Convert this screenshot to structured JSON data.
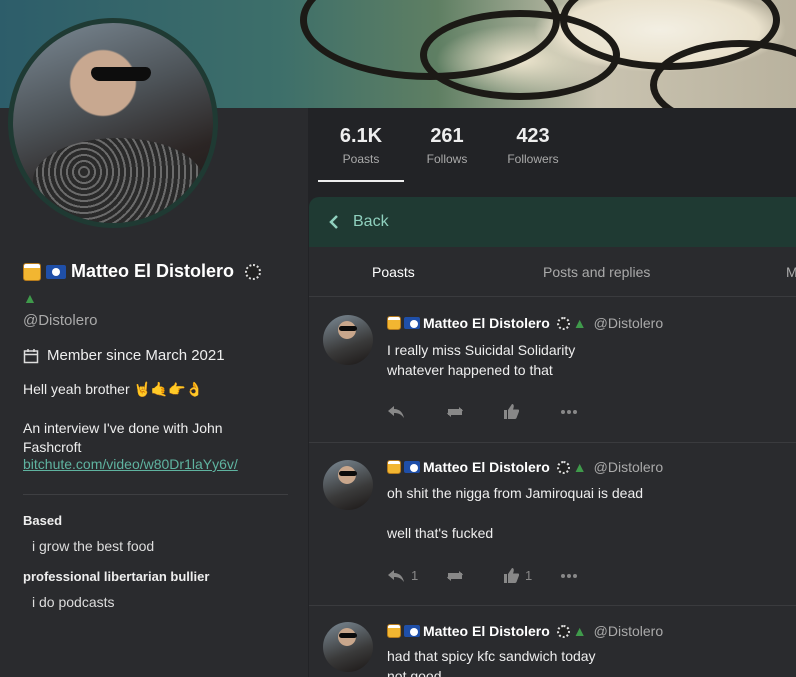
{
  "profile": {
    "display_name": "Matteo El Distolero",
    "handle": "@Distolero",
    "member_since": "Member since March 2021",
    "bio_line1": "Hell yeah brother 🤘🤙👉👌",
    "bio_line2": "An interview I've done with John Fashcroft",
    "bio_link": "bitchute.com/video/w80Dr1laYy6v/",
    "fields": [
      {
        "name": "Based",
        "value": "i grow the best food"
      },
      {
        "name": "professional libertarian bullier",
        "value": "i do podcasts"
      }
    ]
  },
  "stats": [
    {
      "count": "6.1K",
      "label": "Poasts"
    },
    {
      "count": "261",
      "label": "Follows"
    },
    {
      "count": "423",
      "label": "Followers"
    }
  ],
  "nav": {
    "back_label": "Back"
  },
  "tabs": [
    "Poasts",
    "Posts and replies",
    "M"
  ],
  "posts": [
    {
      "name": "Matteo El Distolero",
      "handle": "@Distolero",
      "lines": [
        "I really miss Suicidal Solidarity",
        "whatever happened to that"
      ],
      "reply_count": "",
      "like_count": ""
    },
    {
      "name": "Matteo El Distolero",
      "handle": "@Distolero",
      "lines": [
        "oh shit the nigga from Jamiroquai is dead",
        "",
        "well that's fucked"
      ],
      "reply_count": "1",
      "like_count": "1"
    },
    {
      "name": "Matteo El Distolero",
      "handle": "@Distolero",
      "lines": [
        "had that spicy kfc sandwich today",
        "not good"
      ],
      "reply_count": "",
      "like_count": ""
    }
  ],
  "colors": {
    "accent": "#1f3a33",
    "link": "#5fb3a0",
    "background": "#222326"
  }
}
